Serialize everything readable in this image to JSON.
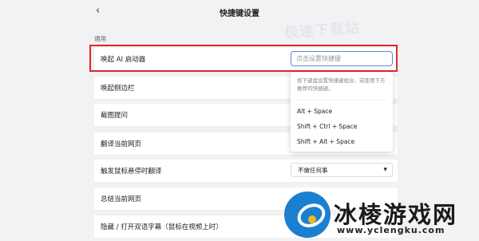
{
  "header": {
    "back_icon": "chevron-left-icon",
    "back_glyph": "‹",
    "title": "快捷键设置"
  },
  "watermark_top": "极速下载站",
  "section_label": "通用",
  "rows": [
    {
      "label": "唤起 AI 启动器"
    },
    {
      "label": "唤起侧边栏"
    },
    {
      "label": "截图提问"
    },
    {
      "label": "翻译当前网页"
    },
    {
      "label": "触发鼠标悬停时翻译"
    },
    {
      "label": "总结当前网页"
    },
    {
      "label": "隐藏 / 打开双语字幕（鼠标在视频上时）"
    }
  ],
  "hotkey_input": {
    "placeholder": "点击设置快捷键",
    "value": ""
  },
  "dropdown": {
    "hint": "按下键盘设置快捷键组合，或使用下方推荐的快捷键。",
    "options": [
      "Alt + Space",
      "Shift + Ctrl + Space",
      "Shift + Alt + Space"
    ]
  },
  "hover_translate_select": {
    "value": "不做任何事",
    "arrow_icon": "caret-down-icon",
    "arrow_glyph": "▼"
  },
  "watermark_logo": {
    "name": "冰棱游戏网",
    "url": "www.yclengku.com"
  },
  "colors": {
    "highlight": "#e8232c",
    "focus": "#5b86e5",
    "logo_blue": "#1b7fd1",
    "logo_yellow": "#f1b81a"
  }
}
